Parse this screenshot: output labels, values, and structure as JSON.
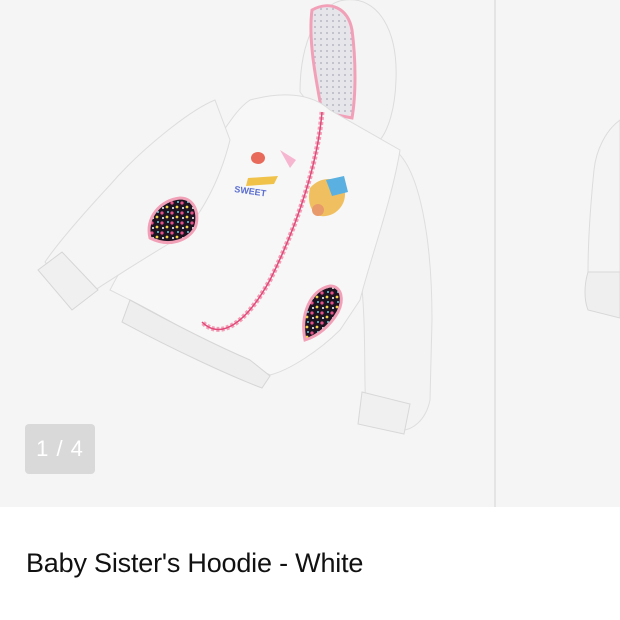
{
  "gallery": {
    "counter": "1 / 4",
    "image_alt": "White baby hoodie with floral pockets and print"
  },
  "product": {
    "title": "Baby Sister's Hoodie - White"
  },
  "colors": {
    "gallery_bg": "#f5f5f5",
    "counter_bg": "#d9d9d9",
    "title_text": "#111111"
  }
}
